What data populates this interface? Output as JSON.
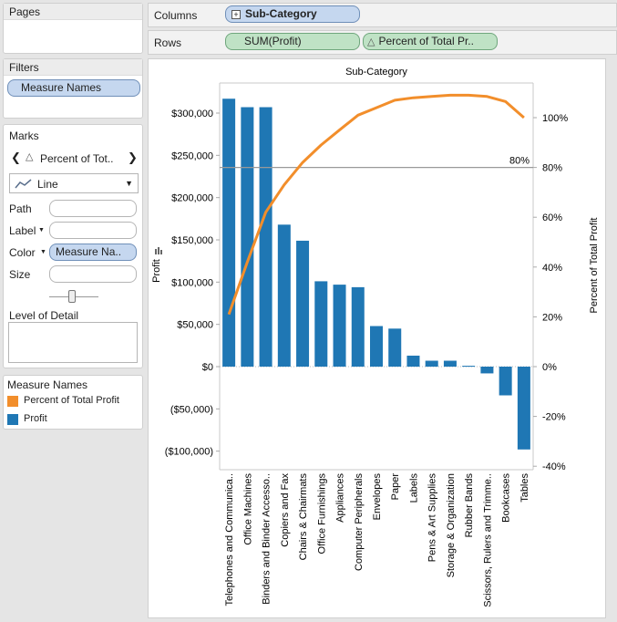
{
  "pages": {
    "title": "Pages"
  },
  "filters": {
    "title": "Filters",
    "items": [
      "Measure Names"
    ]
  },
  "marks": {
    "title": "Marks",
    "selector_label": "Percent of Tot..",
    "mark_type": "Line",
    "path_label": "Path",
    "label_label": "Label",
    "color_label": "Color",
    "color_pill": "Measure Na..",
    "size_label": "Size",
    "detail_label": "Level of Detail"
  },
  "legend": {
    "title": "Measure Names",
    "items": [
      {
        "label": "Percent of Total Profit",
        "color": "#f28e2b"
      },
      {
        "label": "Profit",
        "color": "#1f77b4"
      }
    ]
  },
  "columns": {
    "label": "Columns",
    "pill": "Sub-Category"
  },
  "rows": {
    "label": "Rows",
    "pills": [
      "SUM(Profit)",
      "Percent of Total Pr.."
    ]
  },
  "colors": {
    "bar": "#1f77b4",
    "line": "#f28e2b",
    "reference": "#999999"
  },
  "chart_data": {
    "type": "bar",
    "title": "Sub-Category",
    "ylabel": "Profit",
    "y2label": "Percent of Total Profit",
    "categories": [
      "Telephones and Communica..",
      "Office Machines",
      "Binders and Binder Accesso..",
      "Copiers and Fax",
      "Chairs & Chairmats",
      "Office Furnishings",
      "Appliances",
      "Computer Peripherals",
      "Envelopes",
      "Paper",
      "Labels",
      "Pens & Art Supplies",
      "Storage & Organization",
      "Rubber Bands",
      "Scissors, Rulers and Trimme..",
      "Bookcases",
      "Tables"
    ],
    "series": [
      {
        "name": "Profit",
        "type": "bar",
        "axis": "left",
        "values": [
          317000,
          307000,
          307000,
          168000,
          149000,
          101000,
          97000,
          94000,
          48000,
          45000,
          13000,
          7000,
          7000,
          1000,
          -8000,
          -34000,
          -98000
        ]
      },
      {
        "name": "Percent of Total Profit",
        "type": "line",
        "axis": "right",
        "values": [
          21,
          42,
          62,
          73,
          82,
          89,
          95,
          101,
          104,
          107,
          108,
          108.5,
          109,
          109,
          108.5,
          106.5,
          100
        ]
      }
    ],
    "ylim": [
      -110000,
      325000
    ],
    "yticks": [
      300000,
      250000,
      200000,
      150000,
      100000,
      50000,
      0,
      -50000,
      -100000
    ],
    "yticklabels": [
      "$300,000",
      "$250,000",
      "$200,000",
      "$150,000",
      "$100,000",
      "$50,000",
      "$0",
      "($50,000)",
      "($100,000)"
    ],
    "y2ticks": [
      100,
      80,
      60,
      40,
      20,
      0,
      -20,
      -40
    ],
    "y2ticklabels": [
      "100%",
      "80%",
      "60%",
      "40%",
      "20%",
      "0%",
      "-20%",
      "-40%"
    ],
    "reference_line": {
      "value": 80,
      "label": "80%"
    }
  }
}
